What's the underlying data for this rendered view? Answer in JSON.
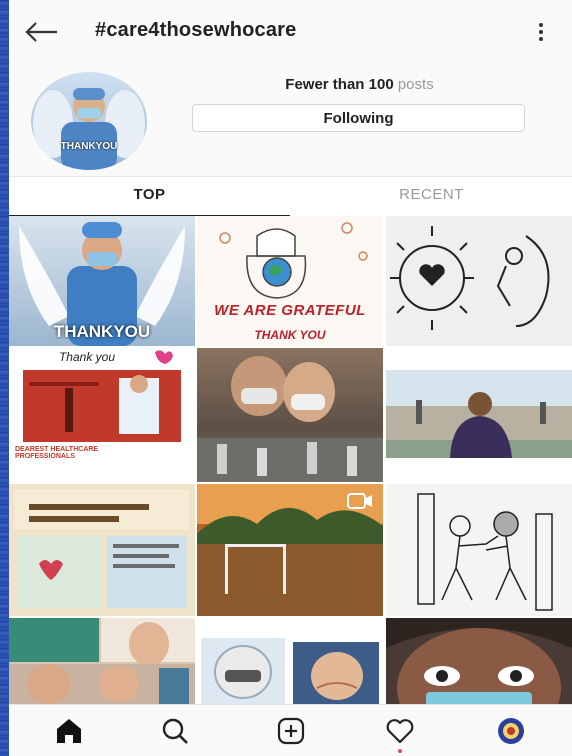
{
  "header": {
    "title": "#care4thosewhocare",
    "back_icon": "arrow-left-icon",
    "more_icon": "more-vertical-icon"
  },
  "profile": {
    "avatar_label": "THANKYOU",
    "post_count": "Fewer than 100",
    "post_unit": "posts",
    "follow_label": "Following"
  },
  "tabs": [
    {
      "label": "TOP",
      "active": true
    },
    {
      "label": "RECENT",
      "active": false
    }
  ],
  "grid": {
    "tiles": [
      {
        "row": 0,
        "col": 0,
        "text": "THANKYOU"
      },
      {
        "row": 0,
        "col": 1,
        "text": "WE ARE GRATEFUL",
        "subtext": "THANK YOU"
      },
      {
        "row": 0,
        "col": 2,
        "text": ""
      },
      {
        "row": 1,
        "col": 0,
        "text": "Thank you",
        "subtext": "DEAREST HEALTHCARE PROFESSIONALS"
      },
      {
        "row": 1,
        "col": 1,
        "text": ""
      },
      {
        "row": 1,
        "col": 2,
        "text": ""
      },
      {
        "row": 2,
        "col": 0,
        "text": ""
      },
      {
        "row": 2,
        "col": 1,
        "text": "",
        "video": true
      },
      {
        "row": 2,
        "col": 2,
        "text": ""
      },
      {
        "row": 3,
        "col": 0,
        "text": ""
      },
      {
        "row": 3,
        "col": 1,
        "text": ""
      },
      {
        "row": 3,
        "col": 2,
        "text": ""
      }
    ]
  },
  "bottom_nav": [
    {
      "icon": "home-icon",
      "active": true
    },
    {
      "icon": "search-icon",
      "active": false
    },
    {
      "icon": "add-post-icon",
      "active": false
    },
    {
      "icon": "heart-icon",
      "active": false,
      "notification": true
    },
    {
      "icon": "profile-avatar-icon",
      "active": false
    }
  ],
  "colors": {
    "text_primary": "#222222",
    "text_secondary": "#999999",
    "notification": "#ed4956",
    "left_edge": "#2a4fa8"
  }
}
